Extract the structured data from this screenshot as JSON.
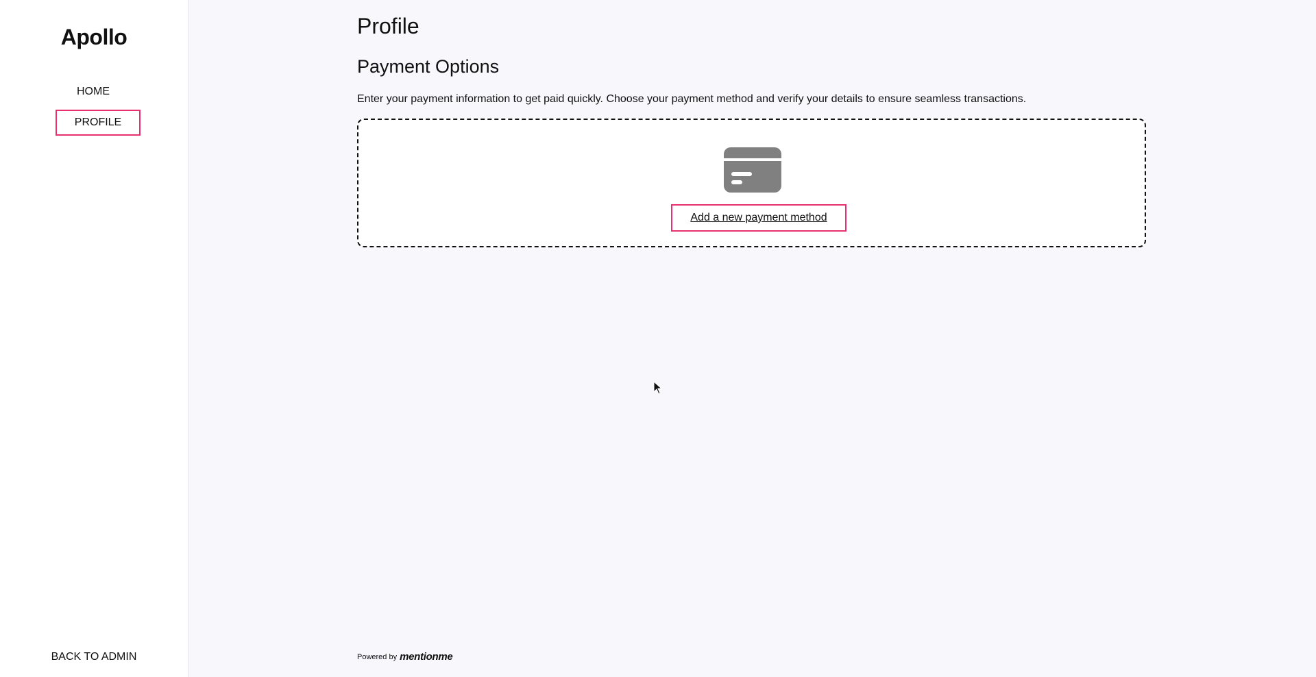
{
  "sidebar": {
    "brand": "Apollo",
    "nav": [
      {
        "label": "HOME"
      },
      {
        "label": "PROFILE"
      }
    ],
    "back_label": "BACK TO ADMIN"
  },
  "main": {
    "page_title": "Profile",
    "section_title": "Payment Options",
    "description": "Enter your payment information to get paid quickly. Choose your payment method and verify your details to ensure seamless transactions.",
    "add_payment_label": "Add a new payment method",
    "card_icon": "credit-card-icon"
  },
  "footer": {
    "powered_by": "Powered by",
    "logo": "mentionme"
  },
  "colors": {
    "highlight": "#e8306f",
    "background": "#f7f7fc",
    "card_icon": "#808080"
  }
}
